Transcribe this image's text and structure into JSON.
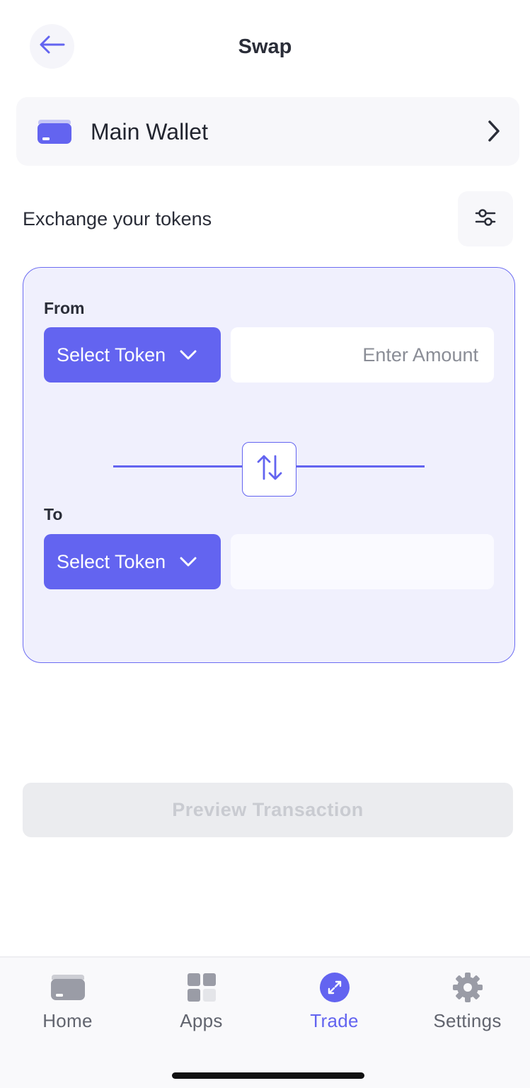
{
  "header": {
    "title": "Swap",
    "back_icon": "arrow-left-icon"
  },
  "wallet": {
    "name": "Main Wallet",
    "icon": "wallet-card-icon",
    "chevron_icon": "chevron-right-icon"
  },
  "exchange": {
    "label": "Exchange your tokens",
    "settings_icon": "sliders-icon"
  },
  "swap_card": {
    "from": {
      "label": "From",
      "token_select_label": "Select Token",
      "amount_placeholder": "Enter Amount",
      "amount_value": ""
    },
    "to": {
      "label": "To",
      "token_select_label": "Select Token",
      "amount_value": ""
    },
    "swap_direction_icon": "swap-arrows-icon"
  },
  "preview_button": {
    "label": "Preview Transaction",
    "enabled": false
  },
  "tab_bar": {
    "tabs": [
      {
        "label": "Home",
        "icon": "wallet-card-icon",
        "active": false
      },
      {
        "label": "Apps",
        "icon": "grid-icon",
        "active": false
      },
      {
        "label": "Trade",
        "icon": "trade-icon",
        "active": true
      },
      {
        "label": "Settings",
        "icon": "gear-icon",
        "active": false
      }
    ]
  },
  "colors": {
    "accent": "#6364f0",
    "card_bg": "#f0f0fd",
    "muted": "#61646e",
    "disabled_bg": "#ebecef"
  }
}
